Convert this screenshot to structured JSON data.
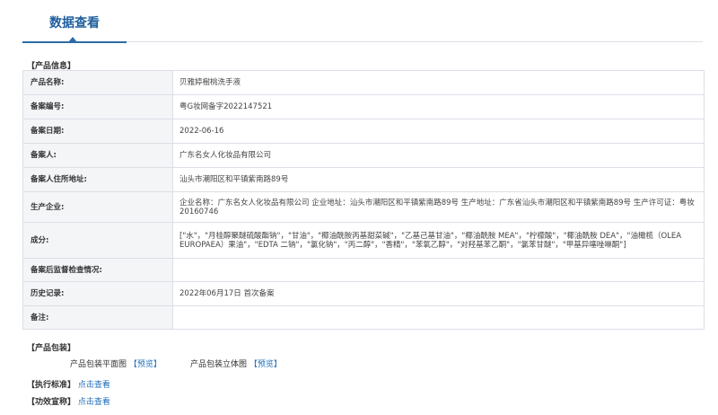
{
  "tab": {
    "label": "数据查看"
  },
  "product_info": {
    "title": "【产品信息】",
    "rows": [
      {
        "label": "产品名称:",
        "value": "贝雅婷樹桃洗手液"
      },
      {
        "label": "备案编号:",
        "value": "粤G妆网备字2022147521"
      },
      {
        "label": "备案日期:",
        "value": "2022-06-16"
      },
      {
        "label": "备案人:",
        "value": "广东名女人化妆品有限公司"
      },
      {
        "label": "备案人住所地址:",
        "value": "汕头市潮阳区和平镇紫南路89号"
      },
      {
        "label": "生产企业:",
        "value": "企业名称：广东名女人化妆品有限公司 企业地址：汕头市潮阳区和平镇紫南路89号 生产地址：广东省汕头市潮阳区和平镇紫南路89号 生产许可证：粤妆20160746"
      },
      {
        "label": "成分:",
        "value": "[\"水\"，\"月桂醇聚醚硫酸酯钠\"，\"甘油\"，\"椰油酰胺丙基甜菜碱\"，\"乙基己基甘油\"，\"椰油酰胺 MEA\"，\"柠檬酸\"，\"椰油酰胺 DEA\"，\"油橄榄（OLEA EUROPAEA）果油\"，\"EDTA 二钠\"，\"氯化钠\"，\"丙二醇\"，\"香精\"，\"苯氧乙醇\"，\"对羟基苯乙酮\"，\"氯苯甘醚\"，\"甲基异噻唑啉酮\"]"
      },
      {
        "label": "备案后监督检查情况:",
        "value": ""
      },
      {
        "label": "历史记录:",
        "value": "2022年06月17日 首次备案"
      },
      {
        "label": "备注:",
        "value": ""
      }
    ]
  },
  "packaging": {
    "title": "【产品包装】",
    "flat_label": "产品包装平面图",
    "flat_link": "【预览】",
    "solid_label": "产品包装立体图",
    "solid_link": "【预览】"
  },
  "standard": {
    "title": "【执行标准】",
    "link": "点击查看"
  },
  "efficacy": {
    "title": "【功效宣称】",
    "link": "点击查看"
  },
  "colors": {
    "accent": "#2d6ba8",
    "link": "#1f6fb8",
    "label_bg": "#f3f5f7",
    "border": "#dcdfe6"
  }
}
